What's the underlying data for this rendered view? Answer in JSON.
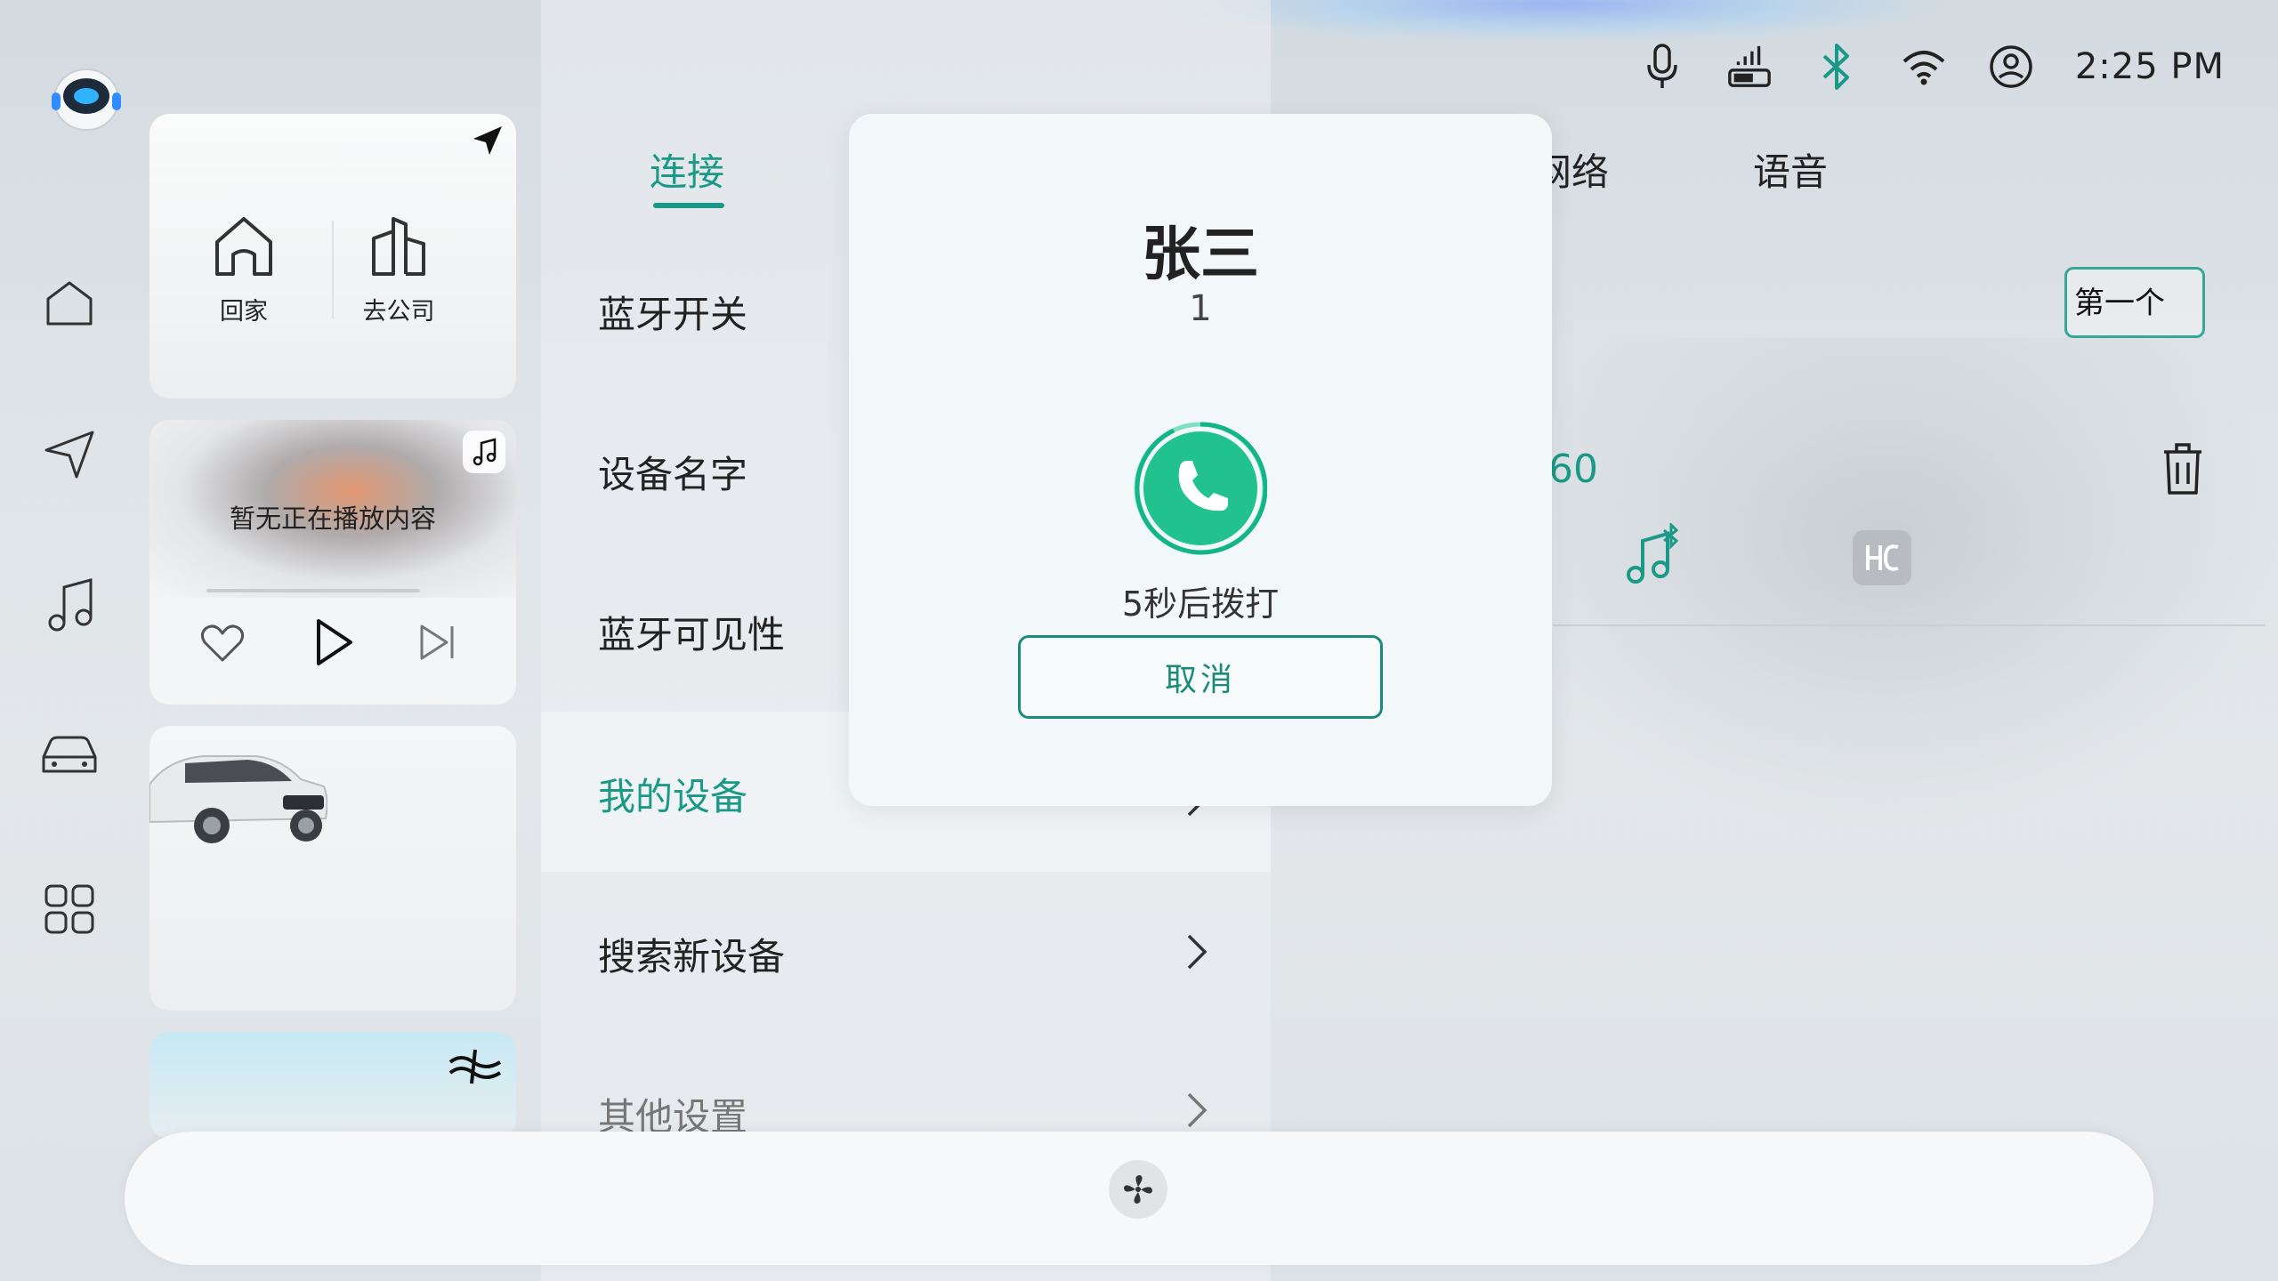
{
  "status_bar": {
    "time": "2:25 PM",
    "icons": [
      "microphone-icon",
      "signal-icon",
      "bluetooth-icon",
      "wifi-icon",
      "user-icon"
    ],
    "accent_color": "#1a9a86"
  },
  "left_rail": {
    "icons": [
      "home-icon",
      "navigation-icon",
      "music-icon",
      "car-icon",
      "apps-icon"
    ]
  },
  "nav_card": {
    "home_label": "回家",
    "company_label": "去公司"
  },
  "music_card": {
    "now_playing": "暂无正在播放内容",
    "progress": 0
  },
  "settings": {
    "tabs": [
      {
        "label": "连接",
        "active": true
      },
      {
        "label": "网络",
        "active": false
      },
      {
        "label": "语音",
        "active": false
      }
    ],
    "menu": [
      {
        "label": "蓝牙开关",
        "active": false,
        "chevron": false
      },
      {
        "label": "设备名字",
        "active": false,
        "chevron": false
      },
      {
        "label": "蓝牙可见性",
        "active": false,
        "chevron": false
      },
      {
        "label": "我的设备",
        "active": true,
        "chevron": true
      },
      {
        "label": "搜索新设备",
        "active": false,
        "chevron": true
      },
      {
        "label": "其他设置",
        "active": false,
        "chevron": true
      }
    ]
  },
  "device_panel": {
    "tag_button": "第一个",
    "value_text": "60",
    "icons": [
      "bluetooth-music-icon",
      "hicar-icon",
      "trash-icon"
    ]
  },
  "call_modal": {
    "caller_name": "张三",
    "caller_number": "1",
    "countdown_text": "5秒后拨打",
    "cancel_label": "取消",
    "call_button_color": "#21c28e"
  },
  "bottom_bar": {
    "icons": [
      "fan-icon"
    ]
  }
}
